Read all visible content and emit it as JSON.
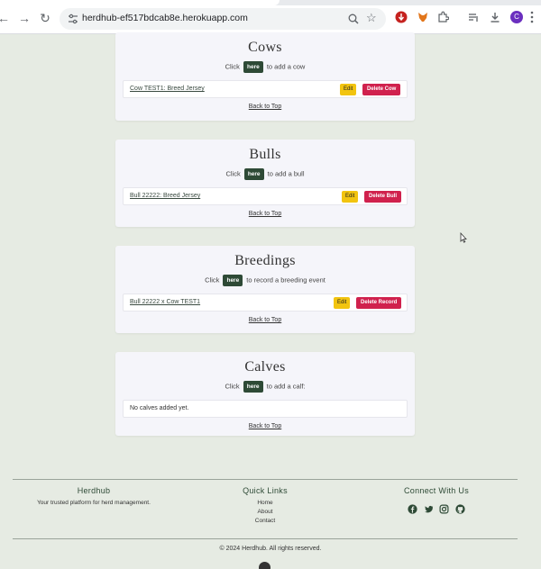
{
  "browser": {
    "url": "herdhub-ef517bdcab8e.herokuapp.com",
    "profile_initial": "C"
  },
  "sections": {
    "cows": {
      "title": "Cows",
      "prompt_before": "Click",
      "here": "here",
      "prompt_after": "to add a cow",
      "item": "Cow TEST1: Breed Jersey",
      "edit": "Edit",
      "delete": "Delete Cow",
      "back": "Back to Top"
    },
    "bulls": {
      "title": "Bulls",
      "prompt_before": "Click",
      "here": "here",
      "prompt_after": "to add a bull",
      "item": "Bull 22222: Breed Jersey",
      "edit": "Edit",
      "delete": "Delete Bull",
      "back": "Back to Top"
    },
    "breedings": {
      "title": "Breedings",
      "prompt_before": "Click",
      "here": "here",
      "prompt_after": "to record a breeding event",
      "item": "Bull 22222 x Cow TEST1",
      "edit": "Edit",
      "delete": "Delete Record",
      "back": "Back to Top"
    },
    "calves": {
      "title": "Calves",
      "prompt_before": "Click",
      "here": "here",
      "prompt_after": "to add a calf:",
      "empty": "No calves added yet.",
      "back": "Back to Top"
    }
  },
  "footer": {
    "brand_title": "Herdhub",
    "brand_tagline": "Your trusted platform for herd management.",
    "quick_links_title": "Quick Links",
    "quick_links": [
      "Home",
      "About",
      "Contact"
    ],
    "connect_title": "Connect With Us",
    "socials": [
      "facebook-icon",
      "twitter-icon",
      "instagram-icon",
      "github-icon"
    ],
    "copyright": "© 2024 Herdhub. All rights reserved."
  },
  "colors": {
    "page_bg": "#e6ebe3",
    "card_bg": "#f5f5fa",
    "here_bg": "#2e4a36",
    "edit_bg": "#f2c40f",
    "delete_bg": "#d0214d"
  }
}
